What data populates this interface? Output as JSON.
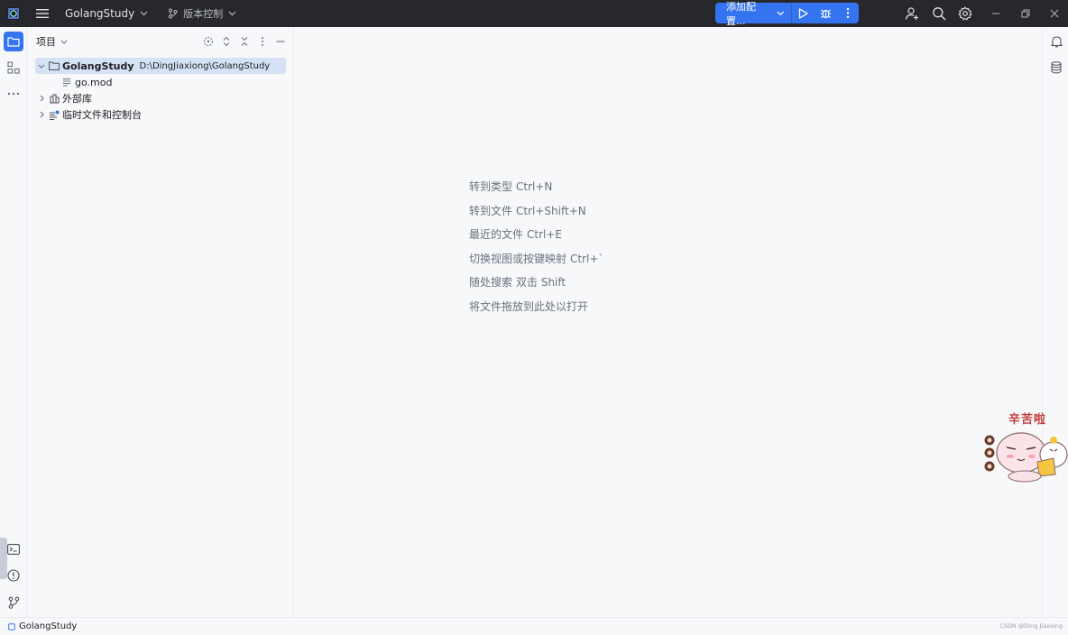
{
  "titlebar": {
    "project_name": "GolangStudy",
    "vcs_label": "版本控制",
    "run_config_label": "添加配置...",
    "colors": {
      "background": "#27282c",
      "accent": "#3574f0"
    }
  },
  "project_panel": {
    "title": "项目",
    "tree": {
      "root_name": "GolangStudy",
      "root_path": "D:\\DingJiaxiong\\GolangStudy",
      "file": "go.mod",
      "external_libs": "外部库",
      "scratches": "临时文件和控制台"
    }
  },
  "editor_hints": [
    {
      "label": "转到类型",
      "shortcut": "Ctrl+N"
    },
    {
      "label": "转到文件",
      "shortcut": "Ctrl+Shift+N"
    },
    {
      "label": "最近的文件",
      "shortcut": "Ctrl+E"
    },
    {
      "label": "切换视图或按键映射",
      "shortcut": "Ctrl+`"
    },
    {
      "label": "随处搜索",
      "shortcut": "双击 Shift"
    },
    {
      "label": "将文件拖放到此处以打开",
      "shortcut": ""
    }
  ],
  "statusbar": {
    "breadcrumb": "GolangStudy",
    "watermark": "CSDN @Ding Jiaxiong"
  },
  "sticker": {
    "caption": "辛苦啦"
  },
  "icons": {
    "app_logo": "goland-logo-icon",
    "menu": "hamburger-menu-icon",
    "project": "folder-icon",
    "structure": "structure-icon",
    "more": "more-horizontal-icon",
    "terminal": "terminal-icon",
    "problems": "problems-icon",
    "git": "git-branch-icon",
    "notifications": "bell-icon",
    "database": "database-icon"
  }
}
